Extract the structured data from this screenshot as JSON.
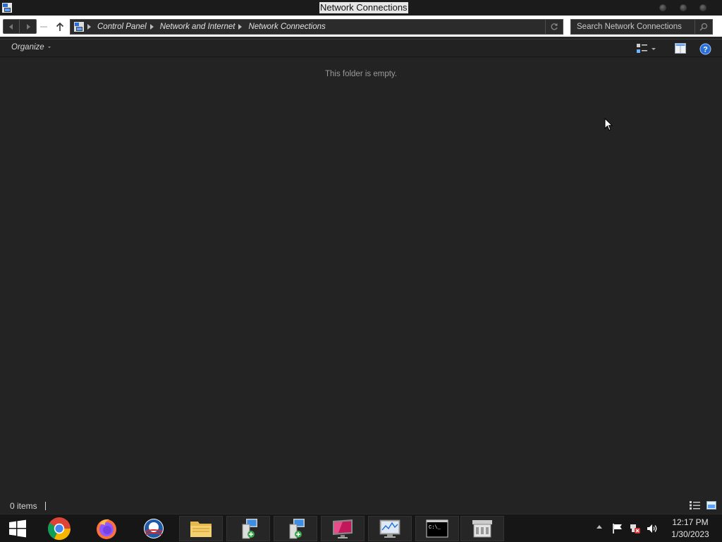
{
  "window": {
    "title": "Network Connections",
    "controls": [
      "minimize-button",
      "maximize-button",
      "close-button"
    ]
  },
  "navigation": {
    "back_icon": "back-arrow-icon",
    "forward_icon": "forward-arrow-icon",
    "up_icon": "up-arrow-icon",
    "breadcrumbs": [
      "Control Panel",
      "Network and Internet",
      "Network Connections"
    ],
    "refresh_icon": "refresh-icon"
  },
  "search": {
    "placeholder": "Search Network Connections",
    "value": "",
    "icon": "search-icon"
  },
  "toolbar": {
    "organize_label": "Organize",
    "view_icon": "change-view-icon",
    "preview_pane_icon": "preview-pane-icon",
    "help_icon": "help-icon"
  },
  "content": {
    "empty_message": "This folder is empty."
  },
  "statusbar": {
    "item_count": "0 items",
    "details_view_icon": "details-view-icon",
    "large_icons_view_icon": "large-icons-view-icon"
  },
  "taskbar": {
    "start_icon": "windows-logo-icon",
    "items": [
      {
        "name": "Google Chrome",
        "icon": "chrome-icon"
      },
      {
        "name": "Firefox",
        "icon": "firefox-icon"
      },
      {
        "name": "Obama campaign",
        "icon": "obama-logo-icon"
      },
      {
        "name": "File Explorer",
        "icon": "folder-icon"
      },
      {
        "name": "Network app",
        "icon": "network-computer-icon"
      },
      {
        "name": "Network app",
        "icon": "network-computer-icon"
      },
      {
        "name": "Display",
        "icon": "monitor-icon"
      },
      {
        "name": "Performance Monitor",
        "icon": "performance-monitor-icon"
      },
      {
        "name": "Command Prompt",
        "icon": "command-prompt-icon"
      },
      {
        "name": "Server Manager",
        "icon": "server-manager-icon"
      }
    ],
    "tray_icons": [
      "flag-icon",
      "network-disconnected-icon",
      "volume-icon"
    ],
    "clock": {
      "time": "12:17 PM",
      "date": "1/30/2023"
    }
  },
  "colors": {
    "window_bg": "#232323",
    "titlebar_bg": "#1b1b1b",
    "address_row_bg": "#ffffff",
    "taskbar_bg": "#161616",
    "accent_blue": "#2a6fd6"
  }
}
